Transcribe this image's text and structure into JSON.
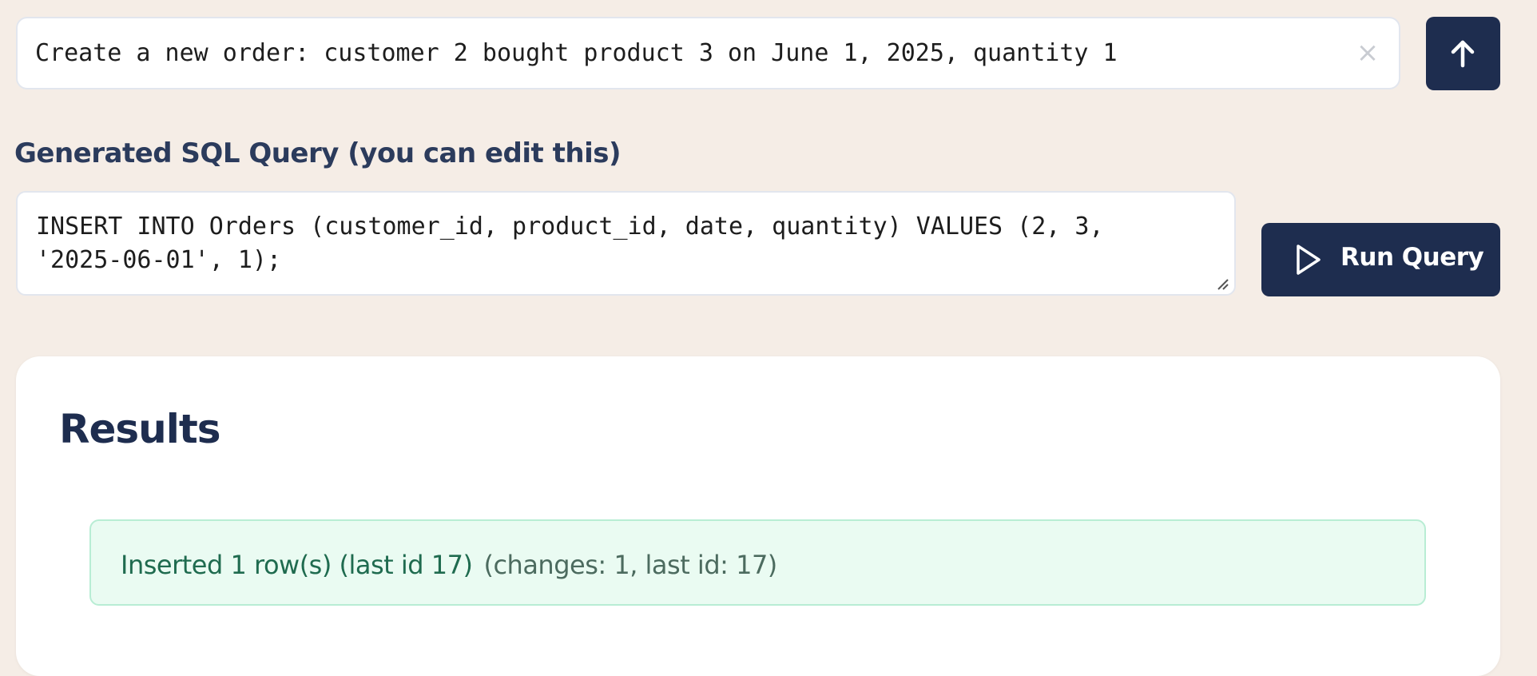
{
  "prompt": {
    "value": "Create a new order: customer 2 bought product 3 on June 1, 2025, quantity 1",
    "clear_icon": "×",
    "submit_icon": "arrow-up-icon"
  },
  "sql": {
    "label": "Generated SQL Query (you can edit this)",
    "query": "INSERT INTO Orders (customer_id, product_id, date, quantity) VALUES (2, 3,\n'2025-06-01', 1);"
  },
  "run_button": {
    "label": "Run Query",
    "icon": "play-icon"
  },
  "results": {
    "title": "Results",
    "message": "Inserted 1 row(s) (last id 17)",
    "detail": "(changes: 1, last id: 17)"
  },
  "colors": {
    "page_background": "#f5ede6",
    "primary_button": "#1e2d4f",
    "success_background": "#eafbf2",
    "success_border": "#b8edd4",
    "success_text": "#1f6b4f"
  }
}
